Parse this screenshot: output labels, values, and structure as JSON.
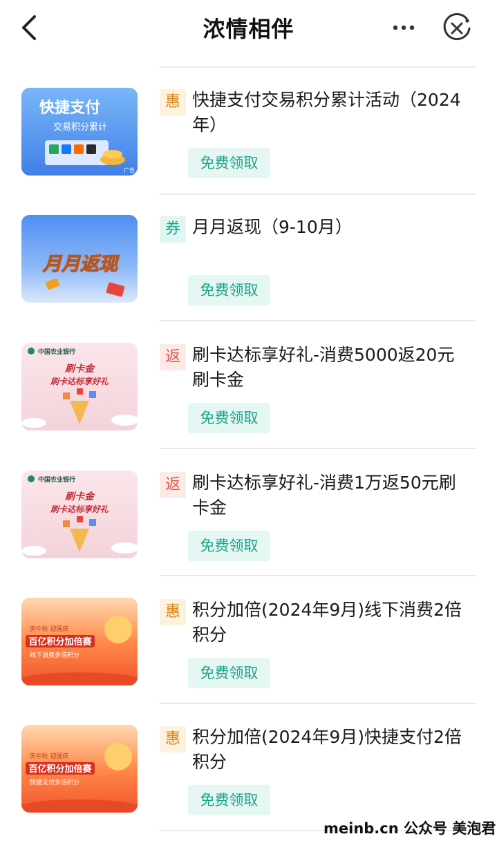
{
  "nav": {
    "title": "浓情相伴"
  },
  "items": [
    {
      "tag": "惠",
      "name": "快捷支付交易积分累计活动（2024年）",
      "action": "免费领取",
      "thumb": {
        "title": "快捷支付",
        "subtitle": "交易积分累计",
        "ad": "广告"
      }
    },
    {
      "tag": "券",
      "name": "月月返现（9-10月）",
      "action": "免费领取",
      "thumb": {
        "title": "月月返现"
      }
    },
    {
      "tag": "返",
      "name": "刷卡达标享好礼-消费5000返20元刷卡金",
      "action": "免费领取",
      "thumb": {
        "bank": "中国农业银行",
        "title": "刷卡金",
        "subtitle": "刷卡达标享好礼"
      }
    },
    {
      "tag": "返",
      "name": "刷卡达标享好礼-消费1万返50元刷卡金",
      "action": "免费领取",
      "thumb": {
        "bank": "中国农业银行",
        "title": "刷卡金",
        "subtitle": "刷卡达标享好礼"
      }
    },
    {
      "tag": "惠",
      "name": "积分加倍(2024年9月)线下消费2倍积分",
      "action": "免费领取",
      "thumb": {
        "top": "庆中秋 迎国庆",
        "title": "百亿积分加倍赛",
        "subtitle": "线下消费多倍积分"
      }
    },
    {
      "tag": "惠",
      "name": "积分加倍(2024年9月)快捷支付2倍积分",
      "action": "免费领取",
      "thumb": {
        "top": "庆中秋 迎国庆",
        "title": "百亿积分加倍赛",
        "subtitle": "快捷支付多倍积分"
      }
    }
  ],
  "watermark": "meinb.cn  公众号 美泡君",
  "colors": {
    "accent": "#1aa58a",
    "button_bg": "#e6f7f3",
    "tag_hui": "#d9861c",
    "tag_fan": "#e0584a"
  }
}
